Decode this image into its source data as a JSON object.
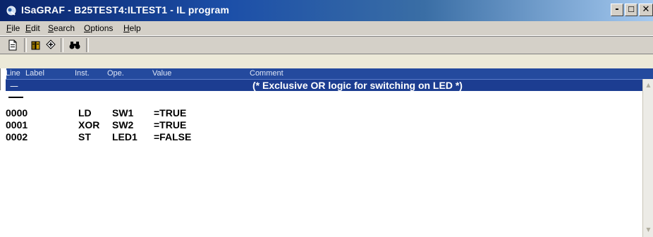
{
  "window": {
    "title": "ISaGRAF - B25TEST4:ILTEST1 - IL program",
    "buttons": {
      "minimize": "-",
      "maximize": "☐",
      "close": "✕"
    }
  },
  "menu": {
    "items": [
      {
        "first": "F",
        "rest": "ile"
      },
      {
        "first": "E",
        "rest": "dit"
      },
      {
        "first": "S",
        "rest": "earch"
      },
      {
        "first": "O",
        "rest": "ptions"
      },
      {
        "first": "H",
        "rest": "elp"
      }
    ]
  },
  "toolbar": {
    "icons": [
      "document-icon",
      "library-icon",
      "compile-icon",
      "binoculars-icon"
    ]
  },
  "columns": {
    "line": "Line",
    "label": "Label",
    "inst": "Inst.",
    "ope": "Ope.",
    "value": "Value",
    "comment": "Comment"
  },
  "banner": {
    "line": "—",
    "comment": "(* Exclusive OR logic for switching on LED *)"
  },
  "rows": [
    {
      "line": "0000",
      "inst": "LD",
      "ope": "SW1",
      "value": "=TRUE"
    },
    {
      "line": "0001",
      "inst": "XOR",
      "ope": "SW2",
      "value": "=TRUE"
    },
    {
      "line": "0002",
      "inst": "ST",
      "ope": "LED1",
      "value": "=FALSE"
    }
  ],
  "colors": {
    "title_gradient_start": "#0a246a",
    "banner_bg": "#1c3d91",
    "header_bg": "#244a9e"
  }
}
